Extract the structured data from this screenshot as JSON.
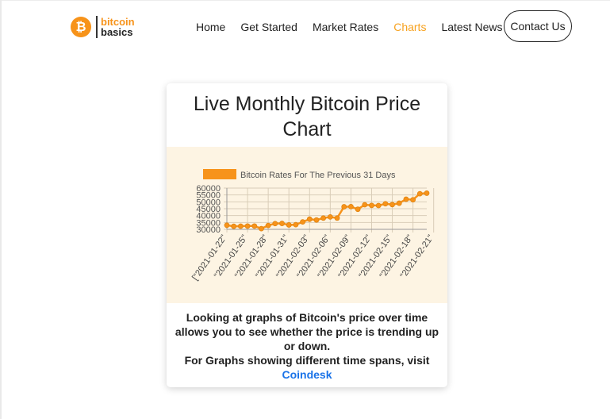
{
  "header": {
    "logo": {
      "line1": "bitcoin",
      "line2": "basics",
      "symbol": "₿"
    },
    "nav": [
      {
        "label": "Home",
        "active": false
      },
      {
        "label": "Get Started",
        "active": false
      },
      {
        "label": "Market Rates",
        "active": false
      },
      {
        "label": "Charts",
        "active": true
      },
      {
        "label": "Latest News",
        "active": false
      }
    ],
    "contact_label": "Contact Us"
  },
  "card": {
    "title": "Live Monthly Bitcoin Price Chart",
    "description": "Looking at graphs of Bitcoin's price over time allows you to see whether the price is trending up or down.",
    "visit_text": "For Graphs showing different time spans, visit",
    "link_text": "Coindesk"
  },
  "colors": {
    "accent": "#f7931a",
    "nav_active": "#f7a21f",
    "link": "#1a73e8",
    "chart_bg": "#fdf4e3"
  },
  "chart_data": {
    "type": "line",
    "legend": "Bitcoin Rates For The Previous 31 Days",
    "legend_placement": "top",
    "ylim": [
      30000,
      60000
    ],
    "yticks": [
      60000,
      55000,
      50000,
      45000,
      40000,
      35000,
      30000
    ],
    "grid": true,
    "x_tick_labels": [
      "[\"2021-01-22\"",
      "\"2021-01-25\"",
      "\"2021-01-28\"",
      "\"2021-01-31\"",
      "\"2021-02-03\"",
      "\"2021-02-06\"",
      "\"2021-02-09\"",
      "\"2021-02-12\"",
      "\"2021-02-15\"",
      "\"2021-02-18\"",
      "\"2021-02-21\""
    ],
    "series": [
      {
        "name": "Bitcoin Rates For The Previous 31 Days",
        "color": "#f7931a",
        "values": [
          33000,
          32200,
          32300,
          32400,
          32400,
          30500,
          32800,
          34200,
          34300,
          33200,
          33400,
          35400,
          37400,
          36800,
          38200,
          39000,
          38200,
          46400,
          46500,
          44600,
          47900,
          47400,
          47300,
          48600,
          48000,
          49000,
          51900,
          51500,
          55900,
          56300
        ]
      }
    ]
  }
}
